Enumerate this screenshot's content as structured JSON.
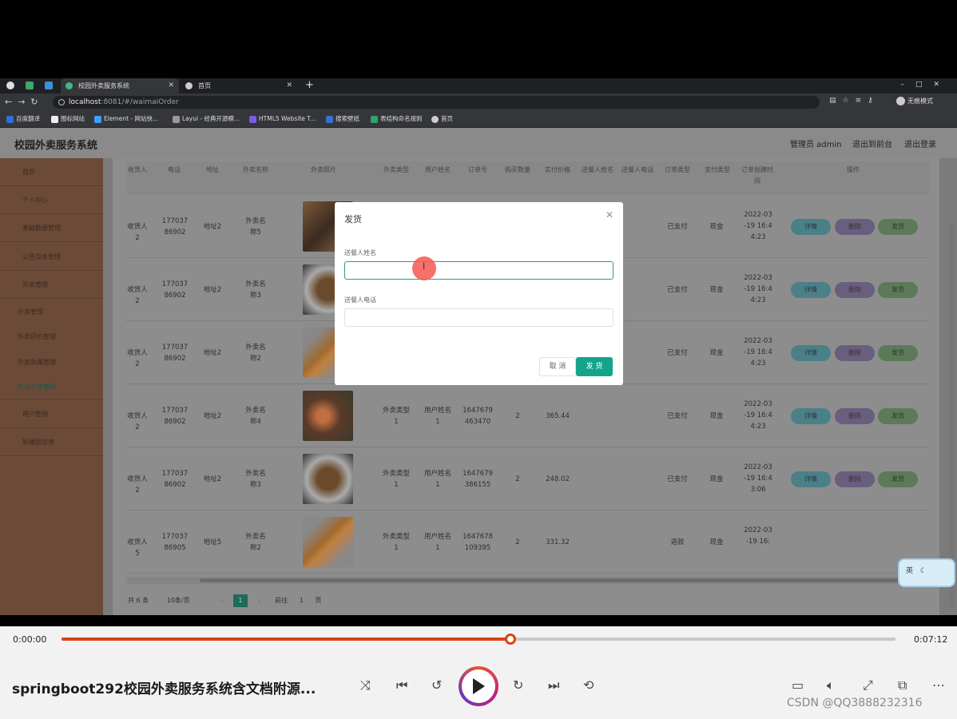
{
  "browser": {
    "tabs": [
      {
        "title": "校园外卖服务系统",
        "active": true
      },
      {
        "title": "首页",
        "active": false
      }
    ],
    "url_host": "localhost",
    "url_path": ":8081/#/waimaiOrder",
    "profile": "无痕模式",
    "bookmarks": [
      "百度翻译",
      "图标网站",
      "Element - 网站快...",
      "Layui - 经典开源模...",
      "HTML5 Website T...",
      "搜索壁纸",
      "表结构命名规则",
      "首页"
    ]
  },
  "app": {
    "brand": "校园外卖服务系统",
    "header_links": [
      "管理员 admin",
      "退出到前台",
      "退出登录"
    ],
    "sidebar": [
      "首页",
      "个人中心",
      "基础数据管理",
      "公告信息管理",
      "外卖管理",
      "外卖管理",
      "外卖评价管理",
      "外卖收藏管理",
      "外卖订单管理",
      "用户管理",
      "轮播图信息"
    ],
    "columns": [
      "收货人",
      "电话",
      "地址",
      "外卖名称",
      "外卖照片",
      "外卖类型",
      "用户姓名",
      "订单号",
      "购买数量",
      "实付价格",
      "送餐人姓名",
      "送餐人电话",
      "订单类型",
      "支付类型",
      "订单创建时间",
      "操作"
    ],
    "rows": [
      {
        "name": "收货人2",
        "phone": "17703786902",
        "addr": "地址2",
        "food": "外卖名称5",
        "type": "",
        "user": "",
        "order_no": "",
        "qty": "",
        "price": "",
        "status": "已支付",
        "pay": "现金",
        "time": "2022-03-19 16:44:23"
      },
      {
        "name": "收货人2",
        "phone": "17703786902",
        "addr": "地址2",
        "food": "外卖名称3",
        "type": "",
        "user": "",
        "order_no": "",
        "qty": "",
        "price": "",
        "status": "已支付",
        "pay": "现金",
        "time": "2022-03-19 16:44:23"
      },
      {
        "name": "收货人2",
        "phone": "17703786902",
        "addr": "地址2",
        "food": "外卖名称2",
        "type": "",
        "user": "",
        "order_no": "",
        "qty": "",
        "price": "",
        "status": "已支付",
        "pay": "现金",
        "time": "2022-03-19 16:44:23"
      },
      {
        "name": "收货人2",
        "phone": "17703786902",
        "addr": "地址2",
        "food": "外卖名称4",
        "type": "外卖类型1",
        "user": "用户姓名1",
        "order_no": "1647679463470",
        "qty": "2",
        "price": "365.44",
        "status": "已支付",
        "pay": "现金",
        "time": "2022-03-19 16:44:23"
      },
      {
        "name": "收货人2",
        "phone": "17703786902",
        "addr": "地址2",
        "food": "外卖名称3",
        "type": "外卖类型1",
        "user": "用户姓名1",
        "order_no": "1647679386155",
        "qty": "2",
        "price": "248.02",
        "status": "已支付",
        "pay": "现金",
        "time": "2022-03-19 16:43:06"
      },
      {
        "name": "收货人5",
        "phone": "17703786905",
        "addr": "地址5",
        "food": "外卖名称2",
        "type": "外卖类型1",
        "user": "用户姓名1",
        "order_no": "1647678109395",
        "qty": "2",
        "price": "331.32",
        "status": "退款",
        "pay": "现金",
        "time": "2022-03-19 16:"
      }
    ],
    "actions": {
      "detail": "详情",
      "delete": "删除",
      "ship": "发货"
    },
    "pager": {
      "total": "共 6 条",
      "size": "10条/页",
      "page": "1",
      "goto": "前往",
      "goto_val": "1",
      "unit": "页"
    }
  },
  "modal": {
    "title": "发货",
    "label1": "送餐人姓名",
    "label2": "送餐人电话",
    "value1": "",
    "value2": "",
    "cancel": "取 消",
    "confirm": "发 货"
  },
  "ime": {
    "lang": "英"
  },
  "player": {
    "current": "0:00:00",
    "total": "0:07:12",
    "progress": 0.538,
    "title": "springboot292校园外卖服务系统含文档附源...",
    "watermark": "CSDN @QQ3888232316",
    "accent": "#d84315"
  }
}
